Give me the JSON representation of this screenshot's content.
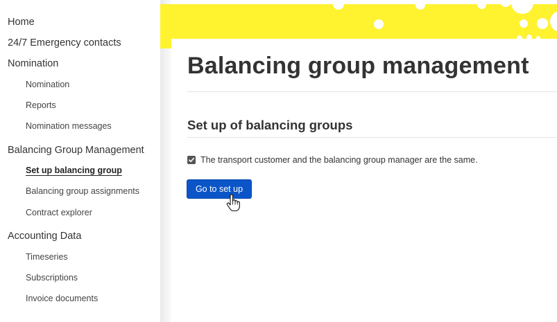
{
  "sidebar": {
    "home": "Home",
    "emergency": "24/7 Emergency contacts",
    "nomination": {
      "label": "Nomination",
      "items": [
        "Nomination",
        "Reports",
        "Nomination messages"
      ]
    },
    "balancing": {
      "label": "Balancing Group Management",
      "items": [
        "Set up balancing group",
        "Balancing group assignments",
        "Contract explorer"
      ],
      "active_index": 0
    },
    "accounting": {
      "label": "Accounting Data",
      "items": [
        "Timeseries",
        "Subscriptions",
        "Invoice documents"
      ]
    }
  },
  "main": {
    "title": "Balancing group management",
    "section_title": "Set up of balancing groups",
    "checkbox_label": "The transport customer and the balancing group manager are the same.",
    "checkbox_checked": true,
    "button_label": "Go to set up"
  },
  "colors": {
    "banner": "#fff22f",
    "button": "#0b55c8",
    "text": "#333333"
  },
  "icons": {
    "checkbox": "check-icon",
    "cursor": "hand-pointer-icon"
  }
}
